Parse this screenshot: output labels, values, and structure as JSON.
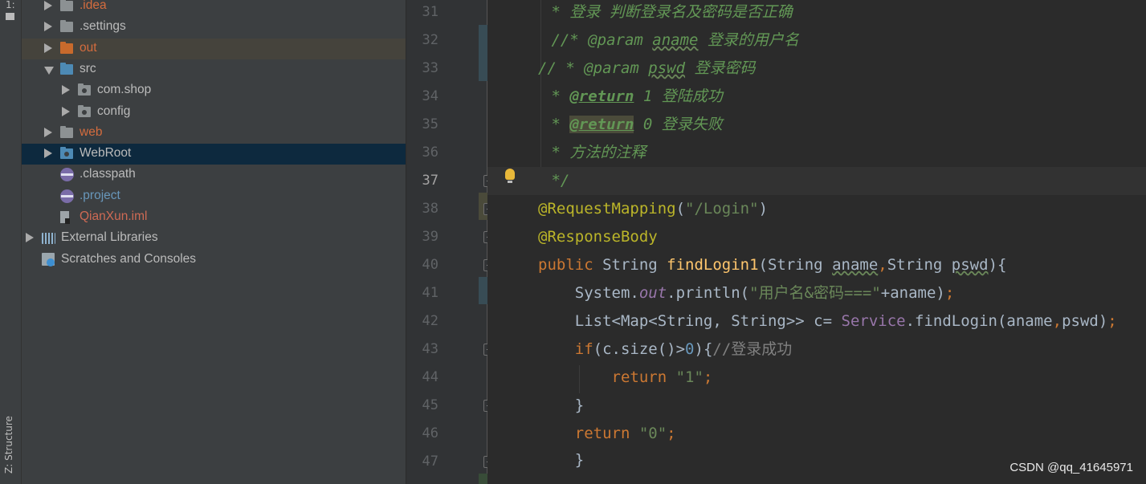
{
  "tool_strip": {
    "project_label": "1:",
    "structure_label": "Z: Structure"
  },
  "tree": [
    {
      "label": ".idea",
      "color": "#d46c3e",
      "icon": "folder-icon",
      "indent": 1,
      "arrow": "right"
    },
    {
      "label": ".settings",
      "color": "#bbbbbb",
      "icon": "folder-icon",
      "indent": 1,
      "arrow": "right"
    },
    {
      "label": "out",
      "color": "#d46c3e",
      "icon": "folder-orange-icon",
      "indent": 1,
      "arrow": "right"
    },
    {
      "label": "src",
      "color": "#bbbbbb",
      "icon": "source-folder-icon",
      "indent": 1,
      "arrow": "down"
    },
    {
      "label": "com.shop",
      "color": "#bbbbbb",
      "icon": "package-icon",
      "indent": 2,
      "arrow": "right"
    },
    {
      "label": "config",
      "color": "#bbbbbb",
      "icon": "package-icon",
      "indent": 2,
      "arrow": "right"
    },
    {
      "label": "web",
      "color": "#d46c3e",
      "icon": "folder-icon",
      "indent": 1,
      "arrow": "right"
    },
    {
      "label": "WebRoot",
      "color": "#bbbbbb",
      "icon": "web-folder-icon",
      "indent": 1,
      "arrow": "right",
      "selected": true
    },
    {
      "label": ".classpath",
      "color": "#bbbbbb",
      "icon": "eclipse-file-icon",
      "indent": 1
    },
    {
      "label": ".project",
      "color": "#6897bb",
      "icon": "eclipse-file-icon",
      "indent": 1
    },
    {
      "label": "QianXun.iml",
      "color": "#cf6a54",
      "icon": "iml-file-icon",
      "indent": 1
    },
    {
      "label": "External Libraries",
      "color": "#bbbbbb",
      "icon": "library-icon",
      "indent": 0,
      "arrow": "right"
    },
    {
      "label": "Scratches and Consoles",
      "color": "#bbbbbb",
      "icon": "scratch-icon",
      "indent": 0
    }
  ],
  "editor": {
    "line_numbers": [
      "31",
      "32",
      "33",
      "34",
      "35",
      "36",
      "37",
      "38",
      "39",
      "40",
      "41",
      "42",
      "43",
      "44",
      "45",
      "46",
      "47"
    ],
    "current_line": "37",
    "code": {
      "l31": " * 登录 判断登录名及密码是否正确",
      "l32_a": " //* @param ",
      "l32_b": "aname",
      "l32_c": " 登录的用户名",
      "l33_a": "// * @param ",
      "l33_b": "pswd",
      "l33_c": " 登录密码",
      "l34_a": " * ",
      "l34_b": "@return",
      "l34_c": " 1 登陆成功",
      "l35_a": " * ",
      "l35_b": "@return",
      "l35_c": " 0 登录失败",
      "l36": " * 方法的注释",
      "l37": " */",
      "l38_a": "@RequestMapping",
      "l38_b": "(",
      "l38_c": "\"/Login\"",
      "l38_d": ")",
      "l39": "@ResponseBody",
      "l40_a": "public ",
      "l40_b": "String ",
      "l40_c": "findLogin1",
      "l40_d": "(String ",
      "l40_e": "aname",
      "l40_f": ",",
      "l40_g": "String ",
      "l40_h": "pswd",
      "l40_i": "){",
      "l41_a": "    System.",
      "l41_b": "out",
      "l41_c": ".println(",
      "l41_d": "\"用户名&密码===\"",
      "l41_e": "+aname)",
      "l41_f": ";",
      "l42_a": "    List<Map<String, String>> c= ",
      "l42_b": "Service",
      "l42_c": ".findLogin(aname",
      "l42_d": ",",
      "l42_e": "pswd)",
      "l42_f": ";",
      "l43_a": "    ",
      "l43_b": "if",
      "l43_c": "(c.size()>",
      "l43_d": "0",
      "l43_e": "){",
      "l43_f": "//登录成功",
      "l44_a": "        ",
      "l44_b": "return ",
      "l44_c": "\"1\"",
      "l44_d": ";",
      "l45": "    }",
      "l46_a": "    ",
      "l46_b": "return ",
      "l46_c": "\"0\"",
      "l46_d": ";",
      "l47": "    }"
    }
  },
  "watermark": "CSDN @qq_41645971"
}
